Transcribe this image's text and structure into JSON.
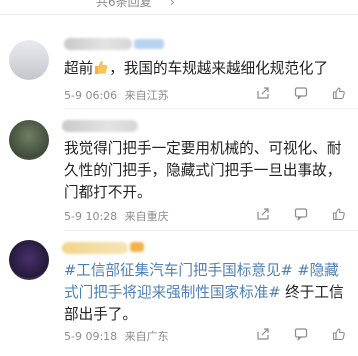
{
  "header": {
    "reply_count": "共6条回复",
    "chevron": "›"
  },
  "comments": [
    {
      "text_before": "超前",
      "text_after": "，我国的车规越来越细化规范化了",
      "date": "5-9 06:06",
      "location": "来自江苏"
    },
    {
      "text": "我觉得门把手一定要用机械的、可视化、耐久性的门把手，隐藏式门把手一旦出事故，门都打不开。",
      "date": "5-9 10:28",
      "location": "来自重庆"
    },
    {
      "tag": "#工信部征集汽车门把手国标意见# #隐藏式门把手将迎来强制性国家标准#",
      "text": " 终于工信部出手了。",
      "date": "5-9 09:18",
      "location": "来自广东"
    }
  ],
  "icons": {
    "share": "share-icon",
    "comment": "comment-icon",
    "like": "like-icon",
    "thumb": "thumbs-up-emoji"
  }
}
